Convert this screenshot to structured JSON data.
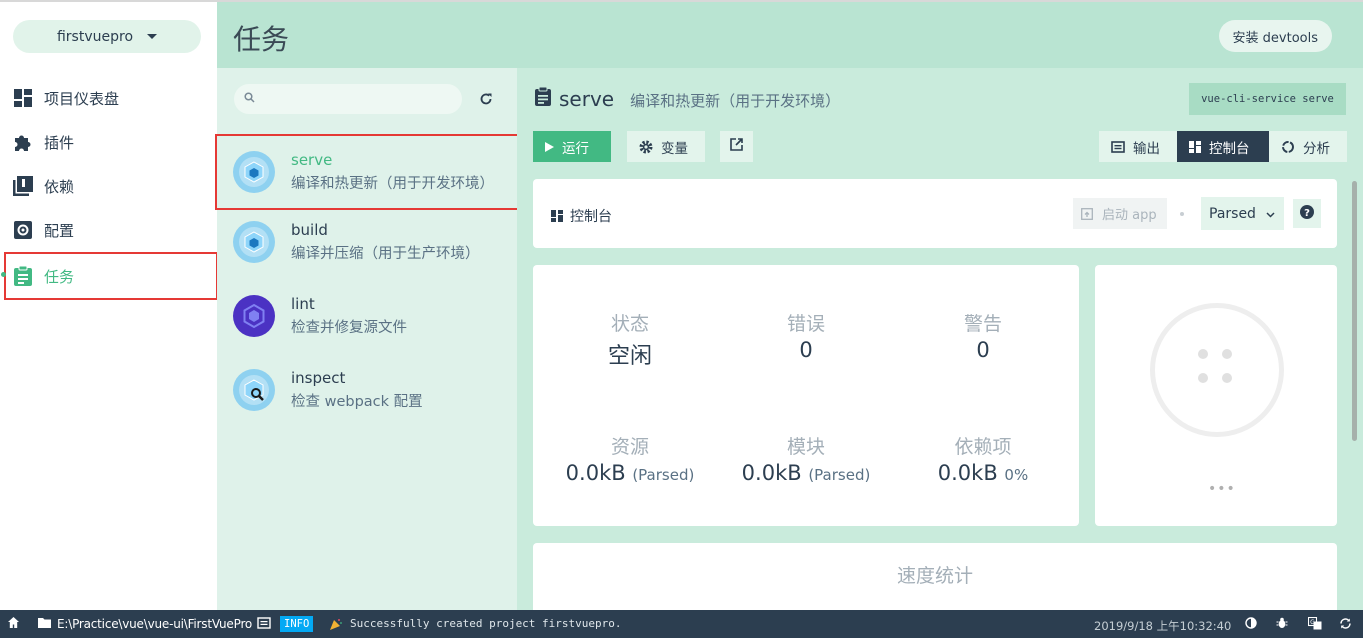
{
  "nav": {
    "project": "firstvuepro",
    "items": [
      {
        "label": "项目仪表盘",
        "icon": "dashboard-icon"
      },
      {
        "label": "插件",
        "icon": "puzzle-icon"
      },
      {
        "label": "依赖",
        "icon": "library-icon"
      },
      {
        "label": "配置",
        "icon": "settings-box-icon"
      },
      {
        "label": "任务",
        "icon": "clipboard-icon"
      }
    ]
  },
  "header": {
    "title": "任务",
    "devtools_label": "安装 devtools"
  },
  "tasks": {
    "search_placeholder": "",
    "items": [
      {
        "name": "serve",
        "desc": "编译和热更新（用于开发环境）"
      },
      {
        "name": "build",
        "desc": "编译并压缩（用于生产环境）"
      },
      {
        "name": "lint",
        "desc": "检查并修复源文件"
      },
      {
        "name": "inspect",
        "desc": "检查 webpack 配置"
      }
    ]
  },
  "main": {
    "task_name": "serve",
    "task_desc": "编译和热更新（用于开发环境）",
    "command": "vue-cli-service serve",
    "buttons": {
      "run": "运行",
      "vars": "变量",
      "output": "输出",
      "console": "控制台",
      "analysis": "分析"
    },
    "console_card": {
      "title": "控制台",
      "start_app": "启动 app",
      "mode": "Parsed"
    },
    "stats": {
      "status_label": "状态",
      "status_value": "空闲",
      "errors_label": "错误",
      "errors_value": "0",
      "warnings_label": "警告",
      "warnings_value": "0",
      "assets_label": "资源",
      "assets_value": "0.0kB",
      "assets_unit": "(Parsed)",
      "modules_label": "模块",
      "modules_value": "0.0kB",
      "modules_unit": "(Parsed)",
      "deps_label": "依赖项",
      "deps_value": "0.0kB",
      "deps_percent": "0%"
    },
    "viz_more": "•••",
    "speed_title": "速度统计"
  },
  "statusbar": {
    "path": "E:\\Practice\\vue\\vue-ui\\FirstVuePro",
    "level": "INFO",
    "message": "Successfully created project firstvuepro.",
    "time": "2019/9/18  上午10:32:40"
  },
  "colors": {
    "accent": "#42b983",
    "dark": "#2c3e50",
    "highlight_border": "#e53935"
  }
}
